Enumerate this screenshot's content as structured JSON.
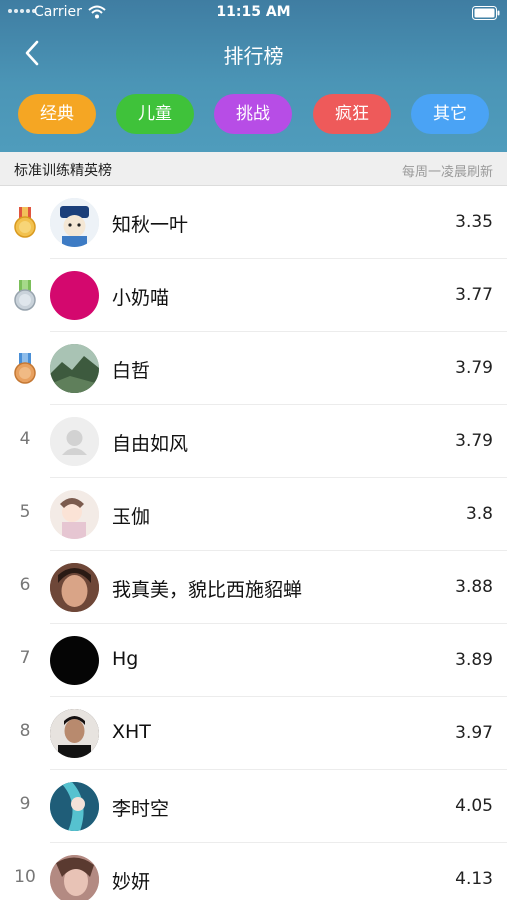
{
  "status_bar": {
    "carrier": "Carrier",
    "time": "11:15 AM"
  },
  "nav": {
    "title": "排行榜",
    "back_icon": "chevron-left-icon"
  },
  "tabs": [
    {
      "label": "经典",
      "color": "#f5a623"
    },
    {
      "label": "儿童",
      "color": "#3fc23a"
    },
    {
      "label": "挑战",
      "color": "#b74de6"
    },
    {
      "label": "疯狂",
      "color": "#ee5a5a"
    },
    {
      "label": "其它",
      "color": "#4aa3f5"
    }
  ],
  "section": {
    "title": "标准训练精英榜",
    "note": "每周一凌晨刷新"
  },
  "rows": [
    {
      "rank": "",
      "medal": "gold-medal-icon",
      "name": "知秋一叶",
      "score": "3.35",
      "avatar_color": "#c8d6e4"
    },
    {
      "rank": "",
      "medal": "silver-medal-icon",
      "name": "小奶喵",
      "score": "3.77",
      "avatar_color": "#d4086e"
    },
    {
      "rank": "",
      "medal": "bronze-medal-icon",
      "name": "白哲",
      "score": "3.79",
      "avatar_color": "#6f8f6a"
    },
    {
      "rank": "4",
      "medal": "",
      "name": "自由如风",
      "score": "3.79",
      "avatar_color": "#e9e9e9"
    },
    {
      "rank": "5",
      "medal": "",
      "name": "玉伽",
      "score": "3.8",
      "avatar_color": "#e7d7d0"
    },
    {
      "rank": "6",
      "medal": "",
      "name": "我真美，貌比西施貂蝉",
      "score": "3.88",
      "avatar_color": "#8a5a48"
    },
    {
      "rank": "7",
      "medal": "",
      "name": "Hg",
      "score": "3.89",
      "avatar_color": "#050505"
    },
    {
      "rank": "8",
      "medal": "",
      "name": "XHT",
      "score": "3.97",
      "avatar_color": "#3a3030"
    },
    {
      "rank": "9",
      "medal": "",
      "name": "李时空",
      "score": "4.05",
      "avatar_color": "#3a9bb0"
    },
    {
      "rank": "10",
      "medal": "",
      "name": "妙妍",
      "score": "4.13",
      "avatar_color": "#c9a29a"
    }
  ]
}
